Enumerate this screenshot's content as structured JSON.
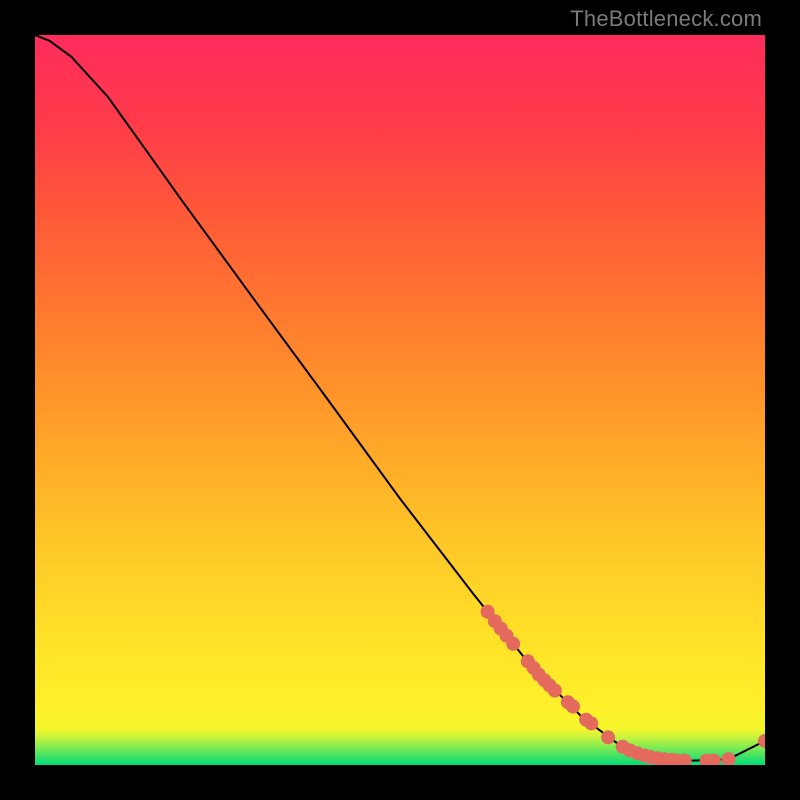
{
  "watermark": "TheBottleneck.com",
  "chart_data": {
    "type": "line",
    "title": "",
    "xlabel": "",
    "ylabel": "",
    "xlim": [
      0,
      100
    ],
    "ylim": [
      0,
      100
    ],
    "gradient_bands": [
      {
        "y": 0,
        "color": "#00e07a"
      },
      {
        "y": 1,
        "color": "#36e06a"
      },
      {
        "y": 2,
        "color": "#6ae85a"
      },
      {
        "y": 3,
        "color": "#9eef4a"
      },
      {
        "y": 4,
        "color": "#d2f53a"
      },
      {
        "y": 5,
        "color": "#f5f52a"
      },
      {
        "y": 8,
        "color": "#fff02a"
      },
      {
        "y": 18,
        "color": "#ffe028"
      },
      {
        "y": 30,
        "color": "#ffc827"
      },
      {
        "y": 45,
        "color": "#ffa329"
      },
      {
        "y": 60,
        "color": "#ff7e2e"
      },
      {
        "y": 75,
        "color": "#ff5a38"
      },
      {
        "y": 88,
        "color": "#ff3b4a"
      },
      {
        "y": 100,
        "color": "#ff2c5c"
      }
    ],
    "curve": [
      {
        "x": 0.0,
        "y": 100.0
      },
      {
        "x": 2.0,
        "y": 99.2
      },
      {
        "x": 5.0,
        "y": 97.0
      },
      {
        "x": 10.0,
        "y": 91.5
      },
      {
        "x": 15.0,
        "y": 84.5
      },
      {
        "x": 20.0,
        "y": 77.5
      },
      {
        "x": 30.0,
        "y": 63.8
      },
      {
        "x": 40.0,
        "y": 50.2
      },
      {
        "x": 50.0,
        "y": 36.5
      },
      {
        "x": 60.0,
        "y": 23.5
      },
      {
        "x": 68.0,
        "y": 13.5
      },
      {
        "x": 75.0,
        "y": 6.5
      },
      {
        "x": 80.0,
        "y": 2.8
      },
      {
        "x": 85.0,
        "y": 1.0
      },
      {
        "x": 90.0,
        "y": 0.6
      },
      {
        "x": 95.0,
        "y": 0.8
      },
      {
        "x": 100.0,
        "y": 3.3
      }
    ],
    "markers": [
      {
        "x": 62.0,
        "y": 21.0
      },
      {
        "x": 63.0,
        "y": 19.7
      },
      {
        "x": 63.8,
        "y": 18.7
      },
      {
        "x": 64.6,
        "y": 17.7
      },
      {
        "x": 65.5,
        "y": 16.6
      },
      {
        "x": 67.5,
        "y": 14.2
      },
      {
        "x": 68.3,
        "y": 13.3
      },
      {
        "x": 69.0,
        "y": 12.4
      },
      {
        "x": 69.8,
        "y": 11.6
      },
      {
        "x": 70.5,
        "y": 10.9
      },
      {
        "x": 71.2,
        "y": 10.2
      },
      {
        "x": 73.0,
        "y": 8.6
      },
      {
        "x": 73.7,
        "y": 8.0
      },
      {
        "x": 75.5,
        "y": 6.2
      },
      {
        "x": 76.2,
        "y": 5.7
      },
      {
        "x": 78.5,
        "y": 3.8
      },
      {
        "x": 80.5,
        "y": 2.5
      },
      {
        "x": 81.5,
        "y": 2.0
      },
      {
        "x": 82.5,
        "y": 1.6
      },
      {
        "x": 83.5,
        "y": 1.3
      },
      {
        "x": 84.3,
        "y": 1.1
      },
      {
        "x": 85.3,
        "y": 0.9
      },
      {
        "x": 86.2,
        "y": 0.8
      },
      {
        "x": 87.2,
        "y": 0.7
      },
      {
        "x": 88.0,
        "y": 0.6
      },
      {
        "x": 89.0,
        "y": 0.6
      },
      {
        "x": 92.0,
        "y": 0.6
      },
      {
        "x": 93.0,
        "y": 0.6
      },
      {
        "x": 95.0,
        "y": 0.8
      },
      {
        "x": 100.0,
        "y": 3.3
      }
    ],
    "marker_style": {
      "color": "#e46a5e",
      "radius": 7
    },
    "curve_style": {
      "color": "#000000",
      "width": 2
    }
  }
}
